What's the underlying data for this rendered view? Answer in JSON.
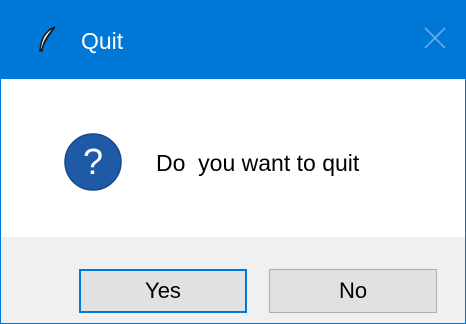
{
  "window": {
    "title": "Quit",
    "app_icon": "feather-icon",
    "close_icon": "close-icon"
  },
  "dialog": {
    "icon": "question-icon",
    "icon_glyph": "?",
    "message": "Do  you want to quit"
  },
  "buttons": {
    "yes_label": "Yes",
    "no_label": "No",
    "default": "yes"
  },
  "colors": {
    "titlebar": "#0078d7",
    "question_icon": "#1f5aa6",
    "button_face": "#e1e1e1",
    "button_area": "#f0f0f0"
  }
}
